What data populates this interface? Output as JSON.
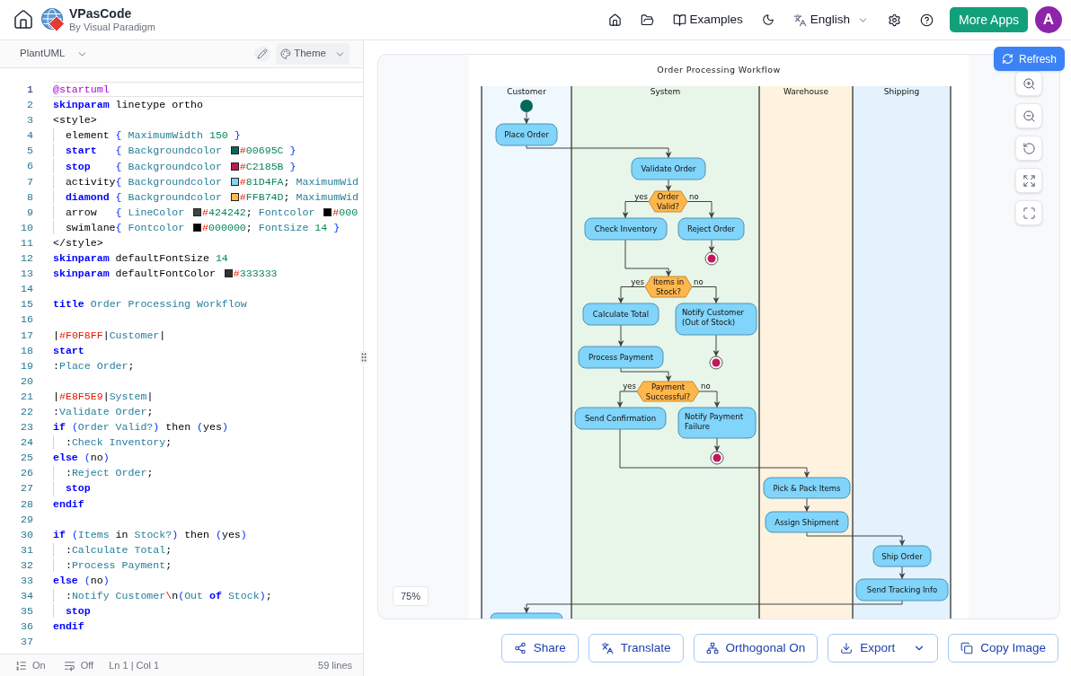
{
  "header": {
    "app_name": "VPasCode",
    "byline": "By Visual Paradigm",
    "examples_label": "Examples",
    "language_label": "English",
    "more_apps_label": "More Apps",
    "avatar_initial": "A"
  },
  "editor": {
    "language": "PlantUML",
    "theme_label": "Theme",
    "lines": [
      {
        "no": "1",
        "current": true,
        "tokens": [
          {
            "kind": "meta",
            "text": "@startuml"
          }
        ]
      },
      {
        "no": "2",
        "current": false,
        "tokens": [
          {
            "kind": "kw",
            "text": "skinparam"
          },
          {
            "kind": "plain",
            "text": " linetype ortho"
          }
        ]
      },
      {
        "no": "3",
        "current": false,
        "tokens": [
          {
            "kind": "plain",
            "text": "<style>"
          }
        ]
      },
      {
        "no": "4",
        "current": false,
        "tokens": [
          {
            "kind": "indent"
          },
          {
            "kind": "plain",
            "text": "element"
          },
          {
            "kind": "brace",
            "text": " {"
          },
          {
            "kind": "attr",
            "text": " MaximumWidth "
          },
          {
            "kind": "num",
            "text": "150"
          },
          {
            "kind": "brace",
            "text": " }"
          }
        ]
      },
      {
        "no": "5",
        "current": false,
        "tokens": [
          {
            "kind": "indent"
          },
          {
            "kind": "kw",
            "text": "start"
          },
          {
            "kind": "brace",
            "text": "   {"
          },
          {
            "kind": "attr",
            "text": " Backgroundcolor "
          },
          {
            "kind": "swatch",
            "color": "#00695c"
          },
          {
            "kind": "hash",
            "text": "#"
          },
          {
            "kind": "num",
            "text": "00695C"
          },
          {
            "kind": "brace",
            "text": " }"
          }
        ]
      },
      {
        "no": "6",
        "current": false,
        "tokens": [
          {
            "kind": "indent"
          },
          {
            "kind": "kw",
            "text": "stop"
          },
          {
            "kind": "brace",
            "text": "    {"
          },
          {
            "kind": "attr",
            "text": " Backgroundcolor "
          },
          {
            "kind": "swatch",
            "color": "#c2185b"
          },
          {
            "kind": "hash",
            "text": "#"
          },
          {
            "kind": "num",
            "text": "C2185B"
          },
          {
            "kind": "brace",
            "text": " }"
          }
        ]
      },
      {
        "no": "7",
        "current": false,
        "tokens": [
          {
            "kind": "indent"
          },
          {
            "kind": "plain",
            "text": "activity"
          },
          {
            "kind": "brace",
            "text": "{"
          },
          {
            "kind": "attr",
            "text": " Backgroundcolor "
          },
          {
            "kind": "swatch",
            "color": "#81d4fa"
          },
          {
            "kind": "hash",
            "text": "#"
          },
          {
            "kind": "num",
            "text": "81D4FA"
          },
          {
            "kind": "plain",
            "text": "; "
          },
          {
            "kind": "attr",
            "text": "MaximumWid"
          }
        ]
      },
      {
        "no": "8",
        "current": false,
        "tokens": [
          {
            "kind": "indent"
          },
          {
            "kind": "kw",
            "text": "diamond"
          },
          {
            "kind": "brace",
            "text": " {"
          },
          {
            "kind": "attr",
            "text": " Backgroundcolor "
          },
          {
            "kind": "swatch",
            "color": "#ffb74d"
          },
          {
            "kind": "hash",
            "text": "#"
          },
          {
            "kind": "num",
            "text": "FFB74D"
          },
          {
            "kind": "plain",
            "text": "; "
          },
          {
            "kind": "attr",
            "text": "MaximumWid"
          }
        ]
      },
      {
        "no": "9",
        "current": false,
        "tokens": [
          {
            "kind": "indent"
          },
          {
            "kind": "plain",
            "text": "arrow"
          },
          {
            "kind": "brace",
            "text": "   {"
          },
          {
            "kind": "attr",
            "text": " LineColor "
          },
          {
            "kind": "swatch",
            "color": "#424242"
          },
          {
            "kind": "hash",
            "text": "#"
          },
          {
            "kind": "num",
            "text": "424242"
          },
          {
            "kind": "plain",
            "text": "; "
          },
          {
            "kind": "attr",
            "text": "Fontcolor "
          },
          {
            "kind": "swatch",
            "color": "#000000"
          },
          {
            "kind": "hash",
            "text": "#"
          },
          {
            "kind": "num",
            "text": "000"
          }
        ]
      },
      {
        "no": "10",
        "current": false,
        "tokens": [
          {
            "kind": "indent"
          },
          {
            "kind": "plain",
            "text": "swimlane"
          },
          {
            "kind": "brace",
            "text": "{"
          },
          {
            "kind": "attr",
            "text": " Fontcolor "
          },
          {
            "kind": "swatch",
            "color": "#000000"
          },
          {
            "kind": "hash",
            "text": "#"
          },
          {
            "kind": "num",
            "text": "000000"
          },
          {
            "kind": "plain",
            "text": "; "
          },
          {
            "kind": "attr",
            "text": "FontSize "
          },
          {
            "kind": "num",
            "text": "14"
          },
          {
            "kind": "brace",
            "text": " }"
          }
        ]
      },
      {
        "no": "11",
        "current": false,
        "tokens": [
          {
            "kind": "plain",
            "text": "</style>"
          }
        ]
      },
      {
        "no": "12",
        "current": false,
        "tokens": [
          {
            "kind": "kw",
            "text": "skinparam"
          },
          {
            "kind": "plain",
            "text": " defaultFontSize "
          },
          {
            "kind": "num",
            "text": "14"
          }
        ]
      },
      {
        "no": "13",
        "current": false,
        "tokens": [
          {
            "kind": "kw",
            "text": "skinparam"
          },
          {
            "kind": "plain",
            "text": " defaultFontColor "
          },
          {
            "kind": "swatch",
            "color": "#333333"
          },
          {
            "kind": "hash",
            "text": "#"
          },
          {
            "kind": "num",
            "text": "333333"
          }
        ]
      },
      {
        "no": "14",
        "current": false
      },
      {
        "no": "15",
        "current": false,
        "tokens": [
          {
            "kind": "kw",
            "text": "title"
          },
          {
            "kind": "attr",
            "text": " Order Processing Workflow"
          }
        ]
      },
      {
        "no": "16",
        "current": false
      },
      {
        "no": "17",
        "current": false,
        "tokens": [
          {
            "kind": "plain",
            "text": "|"
          },
          {
            "kind": "hash",
            "text": "#F0F8FF"
          },
          {
            "kind": "plain",
            "text": "|"
          },
          {
            "kind": "attr",
            "text": "Customer"
          },
          {
            "kind": "plain",
            "text": "|"
          }
        ]
      },
      {
        "no": "18",
        "current": false,
        "tokens": [
          {
            "kind": "kw",
            "text": "start"
          }
        ]
      },
      {
        "no": "19",
        "current": false,
        "tokens": [
          {
            "kind": "plain",
            "text": ":"
          },
          {
            "kind": "attr",
            "text": "Place Order"
          },
          {
            "kind": "plain",
            "text": ";"
          }
        ]
      },
      {
        "no": "20",
        "current": false
      },
      {
        "no": "21",
        "current": false,
        "tokens": [
          {
            "kind": "plain",
            "text": "|"
          },
          {
            "kind": "hash",
            "text": "#E8F5E9"
          },
          {
            "kind": "plain",
            "text": "|"
          },
          {
            "kind": "attr",
            "text": "System"
          },
          {
            "kind": "plain",
            "text": "|"
          }
        ]
      },
      {
        "no": "22",
        "current": false,
        "tokens": [
          {
            "kind": "plain",
            "text": ":"
          },
          {
            "kind": "attr",
            "text": "Validate Order"
          },
          {
            "kind": "plain",
            "text": ";"
          }
        ]
      },
      {
        "no": "23",
        "current": false,
        "tokens": [
          {
            "kind": "kw",
            "text": "if"
          },
          {
            "kind": "brace",
            "text": " ("
          },
          {
            "kind": "attr",
            "text": "Order Valid?"
          },
          {
            "kind": "brace",
            "text": ")"
          },
          {
            "kind": "plain",
            "text": " then "
          },
          {
            "kind": "brace",
            "text": "("
          },
          {
            "kind": "plain",
            "text": "yes"
          },
          {
            "kind": "brace",
            "text": ")"
          }
        ]
      },
      {
        "no": "24",
        "current": false,
        "tokens": [
          {
            "kind": "indent"
          },
          {
            "kind": "plain",
            "text": ":"
          },
          {
            "kind": "attr",
            "text": "Check Inventory"
          },
          {
            "kind": "plain",
            "text": ";"
          }
        ]
      },
      {
        "no": "25",
        "current": false,
        "tokens": [
          {
            "kind": "kw",
            "text": "else"
          },
          {
            "kind": "brace",
            "text": " ("
          },
          {
            "kind": "plain",
            "text": "no"
          },
          {
            "kind": "brace",
            "text": ")"
          }
        ]
      },
      {
        "no": "26",
        "current": false,
        "tokens": [
          {
            "kind": "indent"
          },
          {
            "kind": "plain",
            "text": ":"
          },
          {
            "kind": "attr",
            "text": "Reject Order"
          },
          {
            "kind": "plain",
            "text": ";"
          }
        ]
      },
      {
        "no": "27",
        "current": false,
        "tokens": [
          {
            "kind": "indent"
          },
          {
            "kind": "kw",
            "text": "stop"
          }
        ]
      },
      {
        "no": "28",
        "current": false,
        "tokens": [
          {
            "kind": "kw",
            "text": "endif"
          }
        ]
      },
      {
        "no": "29",
        "current": false
      },
      {
        "no": "30",
        "current": false,
        "tokens": [
          {
            "kind": "kw",
            "text": "if"
          },
          {
            "kind": "brace",
            "text": " ("
          },
          {
            "kind": "attr",
            "text": "Items"
          },
          {
            "kind": "plain",
            "text": " in "
          },
          {
            "kind": "attr",
            "text": "Stock?"
          },
          {
            "kind": "brace",
            "text": ")"
          },
          {
            "kind": "plain",
            "text": " then "
          },
          {
            "kind": "brace",
            "text": "("
          },
          {
            "kind": "plain",
            "text": "yes"
          },
          {
            "kind": "brace",
            "text": ")"
          }
        ]
      },
      {
        "no": "31",
        "current": false,
        "tokens": [
          {
            "kind": "indent"
          },
          {
            "kind": "plain",
            "text": ":"
          },
          {
            "kind": "attr",
            "text": "Calculate Total"
          },
          {
            "kind": "plain",
            "text": ";"
          }
        ]
      },
      {
        "no": "32",
        "current": false,
        "tokens": [
          {
            "kind": "indent"
          },
          {
            "kind": "plain",
            "text": ":"
          },
          {
            "kind": "attr",
            "text": "Process Payment"
          },
          {
            "kind": "plain",
            "text": ";"
          }
        ]
      },
      {
        "no": "33",
        "current": false,
        "tokens": [
          {
            "kind": "kw",
            "text": "else"
          },
          {
            "kind": "brace",
            "text": " ("
          },
          {
            "kind": "plain",
            "text": "no"
          },
          {
            "kind": "brace",
            "text": ")"
          }
        ]
      },
      {
        "no": "34",
        "current": false,
        "tokens": [
          {
            "kind": "indent"
          },
          {
            "kind": "plain",
            "text": ":"
          },
          {
            "kind": "attr",
            "text": "Notify Customer"
          },
          {
            "kind": "hash",
            "text": "\\"
          },
          {
            "kind": "plain",
            "text": "n"
          },
          {
            "kind": "brace",
            "text": "("
          },
          {
            "kind": "attr",
            "text": "Out "
          },
          {
            "kind": "kw",
            "text": "of"
          },
          {
            "kind": "attr",
            "text": " Stock"
          },
          {
            "kind": "brace",
            "text": ")"
          },
          {
            "kind": "plain",
            "text": ";"
          }
        ]
      },
      {
        "no": "35",
        "current": false,
        "tokens": [
          {
            "kind": "indent"
          },
          {
            "kind": "kw",
            "text": "stop"
          }
        ]
      },
      {
        "no": "36",
        "current": false,
        "tokens": [
          {
            "kind": "kw",
            "text": "endif"
          }
        ]
      },
      {
        "no": "37",
        "current": false
      }
    ],
    "status_bar": {
      "line_numbers": "On",
      "word_wrap": "Off",
      "cursor": "Ln 1 | Col 1",
      "line_count": "59 lines"
    }
  },
  "preview": {
    "refresh_label": "Refresh",
    "zoom_level": "75%",
    "diagram": {
      "title": "Order Processing Workflow",
      "lanes": [
        {
          "name": "Customer",
          "color": "#f0f8ff"
        },
        {
          "name": "System",
          "color": "#e8f5e9"
        },
        {
          "name": "Warehouse",
          "color": "#fff3e0"
        },
        {
          "name": "Shipping",
          "color": "#e3f2fd"
        }
      ],
      "nodes": [
        {
          "kind": "start"
        },
        {
          "kind": "activity",
          "lines": [
            "Place Order"
          ]
        },
        {
          "kind": "activity",
          "lines": [
            "Validate Order"
          ]
        },
        {
          "kind": "decision",
          "lines": [
            "Order",
            "Valid?"
          ],
          "yes_label": "yes",
          "no_label": "no"
        },
        {
          "kind": "activity",
          "lines": [
            "Check Inventory"
          ]
        },
        {
          "kind": "activity",
          "lines": [
            "Reject Order"
          ]
        },
        {
          "kind": "stop"
        },
        {
          "kind": "decision",
          "lines": [
            "Items in",
            "Stock?"
          ],
          "yes_label": "yes",
          "no_label": "no"
        },
        {
          "kind": "activity",
          "lines": [
            "Calculate Total"
          ]
        },
        {
          "kind": "activity",
          "lines": [
            "Notify Customer",
            "(Out of Stock)"
          ]
        },
        {
          "kind": "activity",
          "lines": [
            "Process Payment"
          ]
        },
        {
          "kind": "stop"
        },
        {
          "kind": "decision",
          "lines": [
            "Payment",
            "Successful?"
          ],
          "yes_label": "yes",
          "no_label": "no"
        },
        {
          "kind": "activity",
          "lines": [
            "Send Confirmation"
          ]
        },
        {
          "kind": "activity",
          "lines": [
            "Notify Payment",
            "Failure"
          ]
        },
        {
          "kind": "stop"
        },
        {
          "kind": "activity",
          "lines": [
            "Pick & Pack Items"
          ]
        },
        {
          "kind": "activity",
          "lines": [
            "Assign Shipment"
          ]
        },
        {
          "kind": "activity",
          "lines": [
            "Ship Order"
          ]
        },
        {
          "kind": "activity",
          "lines": [
            "Send Tracking Info"
          ]
        },
        {
          "kind": "activity"
        }
      ]
    }
  },
  "actions": [
    {
      "label": "Share",
      "dropdown": false
    },
    {
      "label": "Translate",
      "dropdown": false
    },
    {
      "label": "Orthogonal On",
      "dropdown": false
    },
    {
      "label": "Export",
      "dropdown": true
    },
    {
      "label": "Copy Image",
      "dropdown": false
    }
  ]
}
